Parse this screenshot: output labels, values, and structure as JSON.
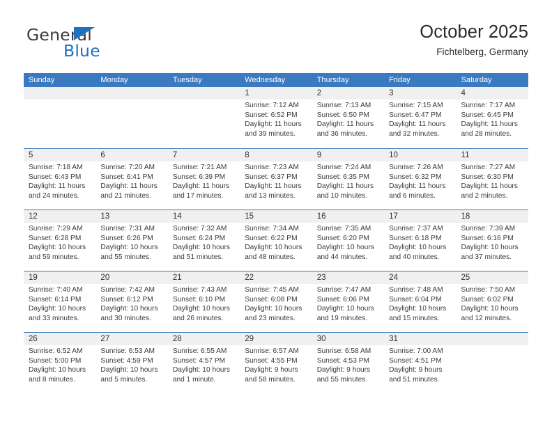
{
  "brand": {
    "name_top": "General",
    "name_bottom": "Blue",
    "triangle_icon": "blue-triangle-icon",
    "color_dark": "#3c3c3c",
    "color_blue": "#1d72bd"
  },
  "header": {
    "title": "October 2025",
    "subtitle": "Fichtelberg, Germany"
  },
  "theme": {
    "header_blue": "#3b7ac0",
    "row_divider": "#3b7ac0",
    "day_strip_gray": "#f0f0f0",
    "text": "#3a3a3a"
  },
  "weekdays": [
    "Sunday",
    "Monday",
    "Tuesday",
    "Wednesday",
    "Thursday",
    "Friday",
    "Saturday"
  ],
  "weeks": [
    {
      "days": [
        {
          "num": "",
          "sunrise": "",
          "sunset": "",
          "daylight_1": "",
          "daylight_2": "",
          "empty": true
        },
        {
          "num": "",
          "sunrise": "",
          "sunset": "",
          "daylight_1": "",
          "daylight_2": "",
          "empty": true
        },
        {
          "num": "",
          "sunrise": "",
          "sunset": "",
          "daylight_1": "",
          "daylight_2": "",
          "empty": true
        },
        {
          "num": "1",
          "sunrise": "Sunrise: 7:12 AM",
          "sunset": "Sunset: 6:52 PM",
          "daylight_1": "Daylight: 11 hours",
          "daylight_2": "and 39 minutes."
        },
        {
          "num": "2",
          "sunrise": "Sunrise: 7:13 AM",
          "sunset": "Sunset: 6:50 PM",
          "daylight_1": "Daylight: 11 hours",
          "daylight_2": "and 36 minutes."
        },
        {
          "num": "3",
          "sunrise": "Sunrise: 7:15 AM",
          "sunset": "Sunset: 6:47 PM",
          "daylight_1": "Daylight: 11 hours",
          "daylight_2": "and 32 minutes."
        },
        {
          "num": "4",
          "sunrise": "Sunrise: 7:17 AM",
          "sunset": "Sunset: 6:45 PM",
          "daylight_1": "Daylight: 11 hours",
          "daylight_2": "and 28 minutes."
        }
      ]
    },
    {
      "days": [
        {
          "num": "5",
          "sunrise": "Sunrise: 7:18 AM",
          "sunset": "Sunset: 6:43 PM",
          "daylight_1": "Daylight: 11 hours",
          "daylight_2": "and 24 minutes."
        },
        {
          "num": "6",
          "sunrise": "Sunrise: 7:20 AM",
          "sunset": "Sunset: 6:41 PM",
          "daylight_1": "Daylight: 11 hours",
          "daylight_2": "and 21 minutes."
        },
        {
          "num": "7",
          "sunrise": "Sunrise: 7:21 AM",
          "sunset": "Sunset: 6:39 PM",
          "daylight_1": "Daylight: 11 hours",
          "daylight_2": "and 17 minutes."
        },
        {
          "num": "8",
          "sunrise": "Sunrise: 7:23 AM",
          "sunset": "Sunset: 6:37 PM",
          "daylight_1": "Daylight: 11 hours",
          "daylight_2": "and 13 minutes."
        },
        {
          "num": "9",
          "sunrise": "Sunrise: 7:24 AM",
          "sunset": "Sunset: 6:35 PM",
          "daylight_1": "Daylight: 11 hours",
          "daylight_2": "and 10 minutes."
        },
        {
          "num": "10",
          "sunrise": "Sunrise: 7:26 AM",
          "sunset": "Sunset: 6:32 PM",
          "daylight_1": "Daylight: 11 hours",
          "daylight_2": "and 6 minutes."
        },
        {
          "num": "11",
          "sunrise": "Sunrise: 7:27 AM",
          "sunset": "Sunset: 6:30 PM",
          "daylight_1": "Daylight: 11 hours",
          "daylight_2": "and 2 minutes."
        }
      ]
    },
    {
      "days": [
        {
          "num": "12",
          "sunrise": "Sunrise: 7:29 AM",
          "sunset": "Sunset: 6:28 PM",
          "daylight_1": "Daylight: 10 hours",
          "daylight_2": "and 59 minutes."
        },
        {
          "num": "13",
          "sunrise": "Sunrise: 7:31 AM",
          "sunset": "Sunset: 6:26 PM",
          "daylight_1": "Daylight: 10 hours",
          "daylight_2": "and 55 minutes."
        },
        {
          "num": "14",
          "sunrise": "Sunrise: 7:32 AM",
          "sunset": "Sunset: 6:24 PM",
          "daylight_1": "Daylight: 10 hours",
          "daylight_2": "and 51 minutes."
        },
        {
          "num": "15",
          "sunrise": "Sunrise: 7:34 AM",
          "sunset": "Sunset: 6:22 PM",
          "daylight_1": "Daylight: 10 hours",
          "daylight_2": "and 48 minutes."
        },
        {
          "num": "16",
          "sunrise": "Sunrise: 7:35 AM",
          "sunset": "Sunset: 6:20 PM",
          "daylight_1": "Daylight: 10 hours",
          "daylight_2": "and 44 minutes."
        },
        {
          "num": "17",
          "sunrise": "Sunrise: 7:37 AM",
          "sunset": "Sunset: 6:18 PM",
          "daylight_1": "Daylight: 10 hours",
          "daylight_2": "and 40 minutes."
        },
        {
          "num": "18",
          "sunrise": "Sunrise: 7:39 AM",
          "sunset": "Sunset: 6:16 PM",
          "daylight_1": "Daylight: 10 hours",
          "daylight_2": "and 37 minutes."
        }
      ]
    },
    {
      "days": [
        {
          "num": "19",
          "sunrise": "Sunrise: 7:40 AM",
          "sunset": "Sunset: 6:14 PM",
          "daylight_1": "Daylight: 10 hours",
          "daylight_2": "and 33 minutes."
        },
        {
          "num": "20",
          "sunrise": "Sunrise: 7:42 AM",
          "sunset": "Sunset: 6:12 PM",
          "daylight_1": "Daylight: 10 hours",
          "daylight_2": "and 30 minutes."
        },
        {
          "num": "21",
          "sunrise": "Sunrise: 7:43 AM",
          "sunset": "Sunset: 6:10 PM",
          "daylight_1": "Daylight: 10 hours",
          "daylight_2": "and 26 minutes."
        },
        {
          "num": "22",
          "sunrise": "Sunrise: 7:45 AM",
          "sunset": "Sunset: 6:08 PM",
          "daylight_1": "Daylight: 10 hours",
          "daylight_2": "and 23 minutes."
        },
        {
          "num": "23",
          "sunrise": "Sunrise: 7:47 AM",
          "sunset": "Sunset: 6:06 PM",
          "daylight_1": "Daylight: 10 hours",
          "daylight_2": "and 19 minutes."
        },
        {
          "num": "24",
          "sunrise": "Sunrise: 7:48 AM",
          "sunset": "Sunset: 6:04 PM",
          "daylight_1": "Daylight: 10 hours",
          "daylight_2": "and 15 minutes."
        },
        {
          "num": "25",
          "sunrise": "Sunrise: 7:50 AM",
          "sunset": "Sunset: 6:02 PM",
          "daylight_1": "Daylight: 10 hours",
          "daylight_2": "and 12 minutes."
        }
      ]
    },
    {
      "days": [
        {
          "num": "26",
          "sunrise": "Sunrise: 6:52 AM",
          "sunset": "Sunset: 5:00 PM",
          "daylight_1": "Daylight: 10 hours",
          "daylight_2": "and 8 minutes."
        },
        {
          "num": "27",
          "sunrise": "Sunrise: 6:53 AM",
          "sunset": "Sunset: 4:59 PM",
          "daylight_1": "Daylight: 10 hours",
          "daylight_2": "and 5 minutes."
        },
        {
          "num": "28",
          "sunrise": "Sunrise: 6:55 AM",
          "sunset": "Sunset: 4:57 PM",
          "daylight_1": "Daylight: 10 hours",
          "daylight_2": "and 1 minute."
        },
        {
          "num": "29",
          "sunrise": "Sunrise: 6:57 AM",
          "sunset": "Sunset: 4:55 PM",
          "daylight_1": "Daylight: 9 hours",
          "daylight_2": "and 58 minutes."
        },
        {
          "num": "30",
          "sunrise": "Sunrise: 6:58 AM",
          "sunset": "Sunset: 4:53 PM",
          "daylight_1": "Daylight: 9 hours",
          "daylight_2": "and 55 minutes."
        },
        {
          "num": "31",
          "sunrise": "Sunrise: 7:00 AM",
          "sunset": "Sunset: 4:51 PM",
          "daylight_1": "Daylight: 9 hours",
          "daylight_2": "and 51 minutes."
        },
        {
          "num": "",
          "sunrise": "",
          "sunset": "",
          "daylight_1": "",
          "daylight_2": "",
          "empty": true
        }
      ]
    }
  ]
}
